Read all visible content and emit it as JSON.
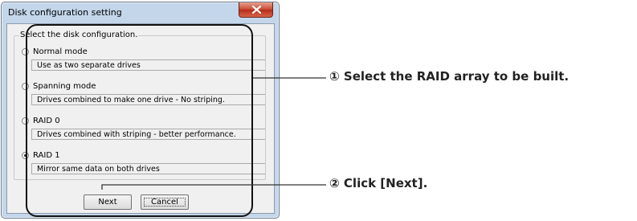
{
  "dialog": {
    "title": "Disk configuration setting",
    "group_label": "Select the disk configuration.",
    "options": [
      {
        "label": "Normal mode",
        "description": "Use as two separate drives",
        "selected": false
      },
      {
        "label": "Spanning mode",
        "description": "Drives combined to make one drive - No striping.",
        "selected": false
      },
      {
        "label": "RAID 0",
        "description": "Drives combined with striping - better performance.",
        "selected": false
      },
      {
        "label": "RAID 1",
        "description": "Mirror same data on both drives",
        "selected": true
      }
    ],
    "buttons": {
      "next": "Next",
      "cancel": "Cancel"
    }
  },
  "callouts": [
    {
      "text": "① Select the RAID array to be built."
    },
    {
      "text": "② Click [Next]."
    }
  ]
}
